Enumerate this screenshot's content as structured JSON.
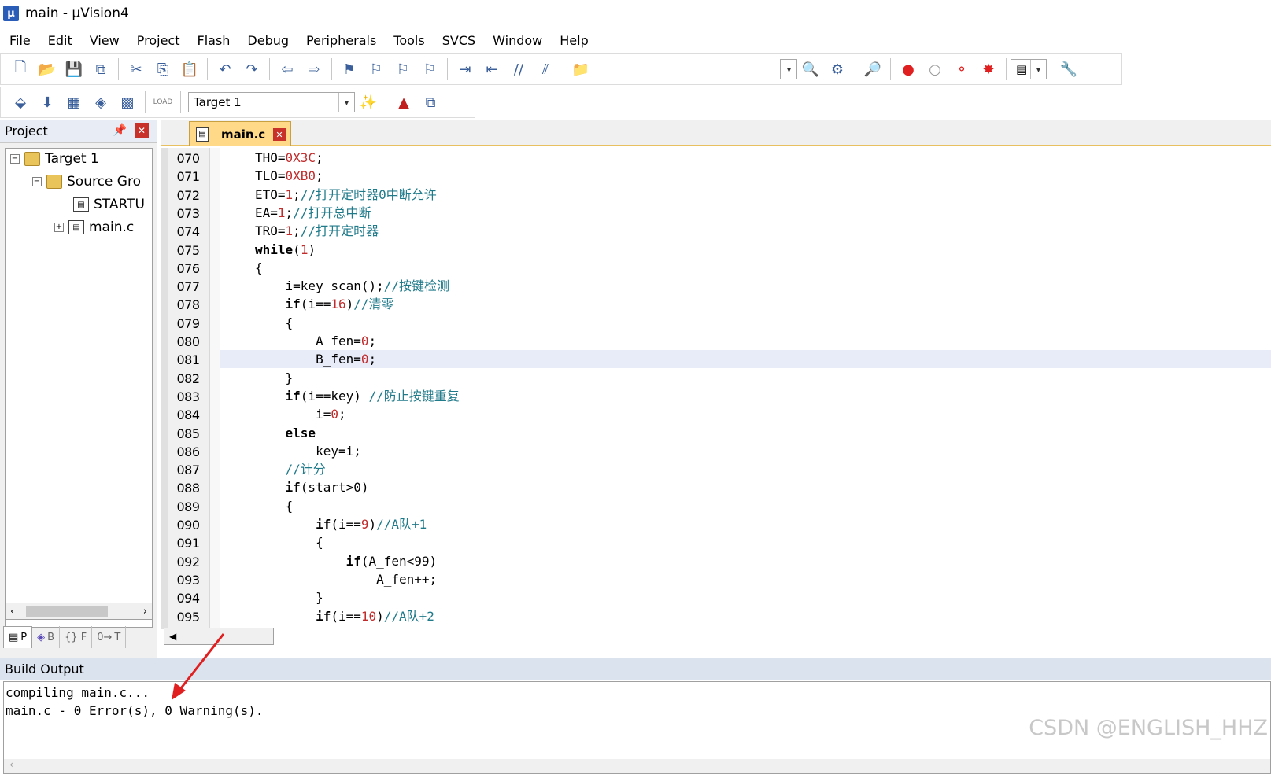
{
  "window": {
    "title": "main  - µVision4"
  },
  "menu": [
    "File",
    "Edit",
    "View",
    "Project",
    "Flash",
    "Debug",
    "Peripherals",
    "Tools",
    "SVCS",
    "Window",
    "Help"
  ],
  "toolbar": {
    "target_name": "Target 1"
  },
  "project": {
    "header": "Project",
    "tree": [
      {
        "label": "Target 1"
      },
      {
        "label": "Source Gro"
      },
      {
        "label": "STARTU"
      },
      {
        "label": "main.c"
      }
    ],
    "tabs": [
      "P",
      "B",
      "{} F",
      "T"
    ]
  },
  "editor": {
    "tab_label": "main.c",
    "lines": [
      {
        "no": "070",
        "code": "THO=0X3C;"
      },
      {
        "no": "071",
        "code": "TLO=0XB0;"
      },
      {
        "no": "072",
        "code": "ETO=1;//打开定时器0中断允许"
      },
      {
        "no": "073",
        "code": "EA=1;//打开总中断"
      },
      {
        "no": "074",
        "code": "TRO=1;//打开定时器"
      },
      {
        "no": "075",
        "code": "while(1)"
      },
      {
        "no": "076",
        "code": "{"
      },
      {
        "no": "077",
        "code": "    i=key_scan();//按键检测"
      },
      {
        "no": "078",
        "code": "    if(i==16)//清零"
      },
      {
        "no": "079",
        "code": "    {"
      },
      {
        "no": "080",
        "code": "        A_fen=0;"
      },
      {
        "no": "081",
        "code": "        B_fen=0;"
      },
      {
        "no": "082",
        "code": "    }"
      },
      {
        "no": "083",
        "code": "    if(i==key) //防止按键重复"
      },
      {
        "no": "084",
        "code": "        i=0;"
      },
      {
        "no": "085",
        "code": "    else"
      },
      {
        "no": "086",
        "code": "        key=i;"
      },
      {
        "no": "087",
        "code": "    //计分"
      },
      {
        "no": "088",
        "code": "    if(start>0)"
      },
      {
        "no": "089",
        "code": "    {"
      },
      {
        "no": "090",
        "code": "        if(i==9)//A队+1"
      },
      {
        "no": "091",
        "code": "        {"
      },
      {
        "no": "092",
        "code": "            if(A_fen<99)"
      },
      {
        "no": "093",
        "code": "                A_fen++;"
      },
      {
        "no": "094",
        "code": "        }"
      },
      {
        "no": "095",
        "code": "        if(i==10)//A队+2"
      }
    ]
  },
  "build": {
    "header": "Build Output",
    "lines": [
      "compiling main.c...",
      "main.c - 0 Error(s), 0 Warning(s)."
    ]
  },
  "watermark": "CSDN @ENGLISH_HHZ",
  "colors": {
    "keyword": "#000000",
    "number": "#c02c2c",
    "comment": "#1f7a8a",
    "current_line": "#e8ecf8",
    "arrow": "#e02020"
  }
}
